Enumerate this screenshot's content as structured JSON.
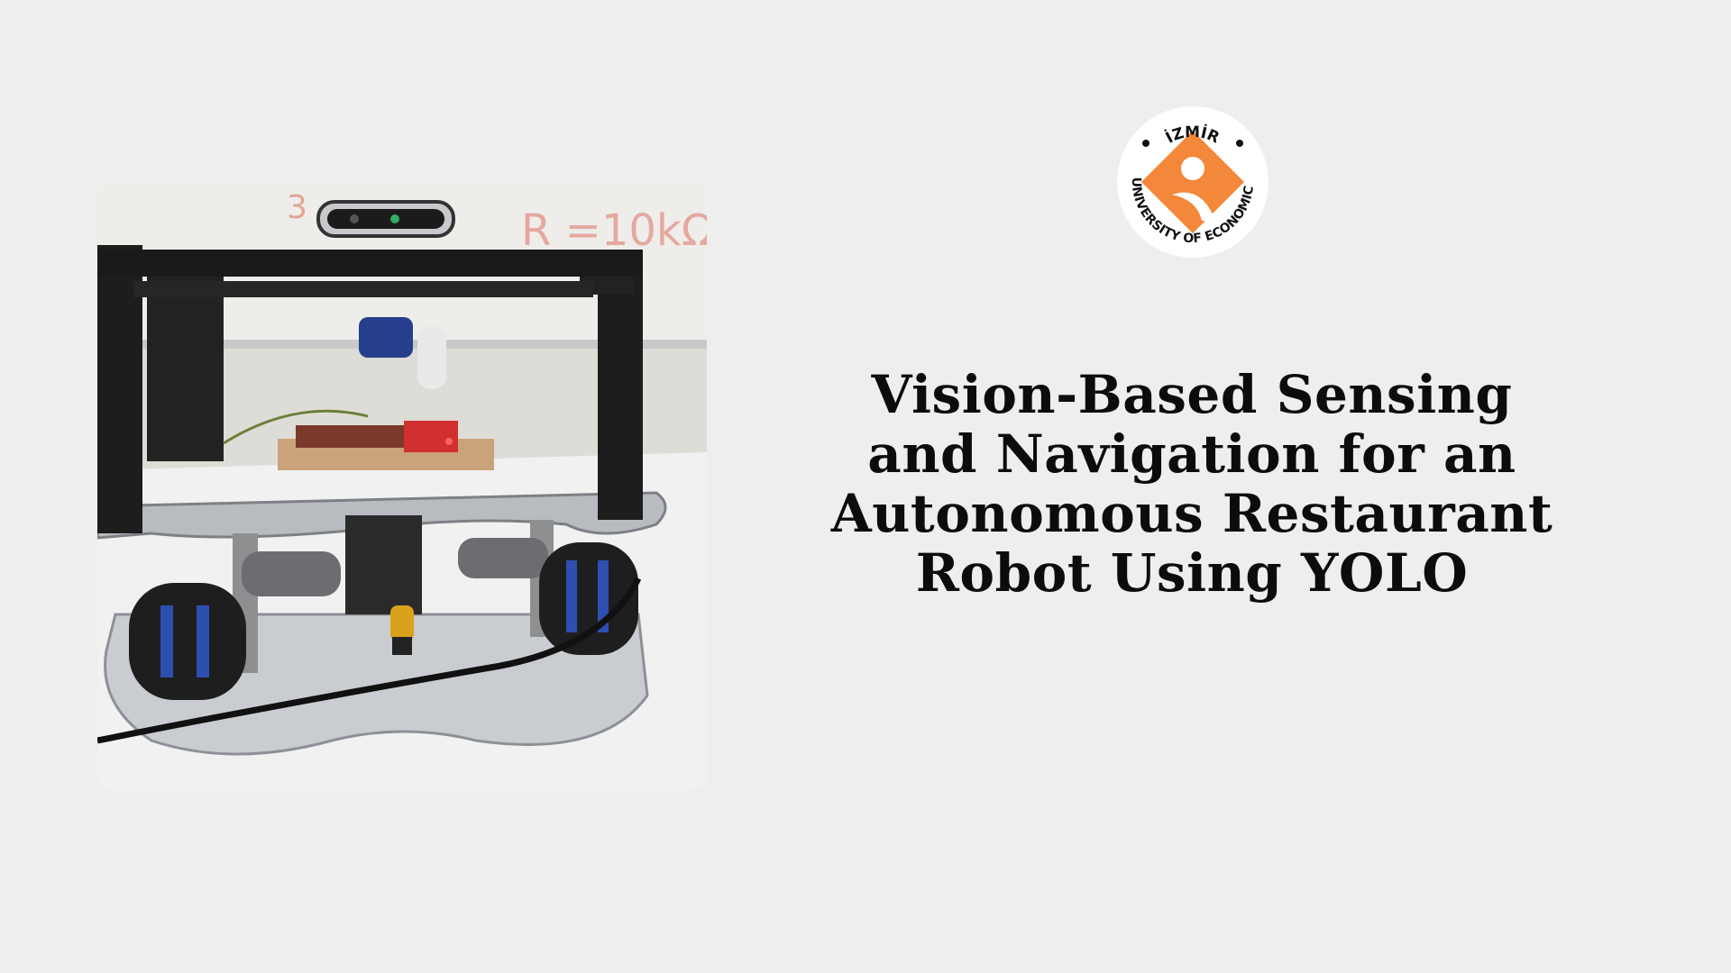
{
  "slide": {
    "title_lines": [
      "Vision-Based Sensing",
      "and Navigation for an",
      "Autonomous Restaurant",
      "Robot Using YOLO"
    ],
    "logo": {
      "top_text": "İZMİR",
      "bottom_text": "UNIVERSITY OF ECONOMICS",
      "accent_color": "#f3873a"
    },
    "photo": {
      "subject": "robot-prototype-photo"
    }
  }
}
